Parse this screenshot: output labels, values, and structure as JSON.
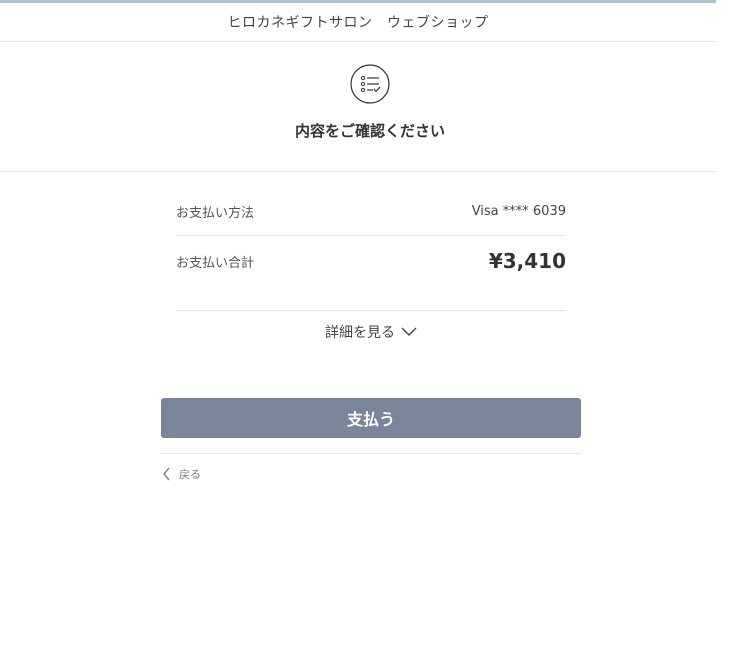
{
  "header": {
    "store_name": "ヒロカネギフトサロン　ウェブショップ"
  },
  "confirm": {
    "icon": "checklist-icon",
    "title": "内容をご確認ください"
  },
  "summary": {
    "payment_method_label": "お支払い方法",
    "payment_method_value": "Visa **** 6039",
    "total_label": "お支払い合計",
    "total_value": "¥3,410"
  },
  "details": {
    "label": "詳細を見る",
    "icon": "chevron-down-icon"
  },
  "actions": {
    "pay_label": "支払う",
    "back_label": "戻る",
    "back_icon": "chevron-left-icon"
  },
  "colors": {
    "pay_button": "#798699",
    "top_accent": "#a9c3cf"
  }
}
